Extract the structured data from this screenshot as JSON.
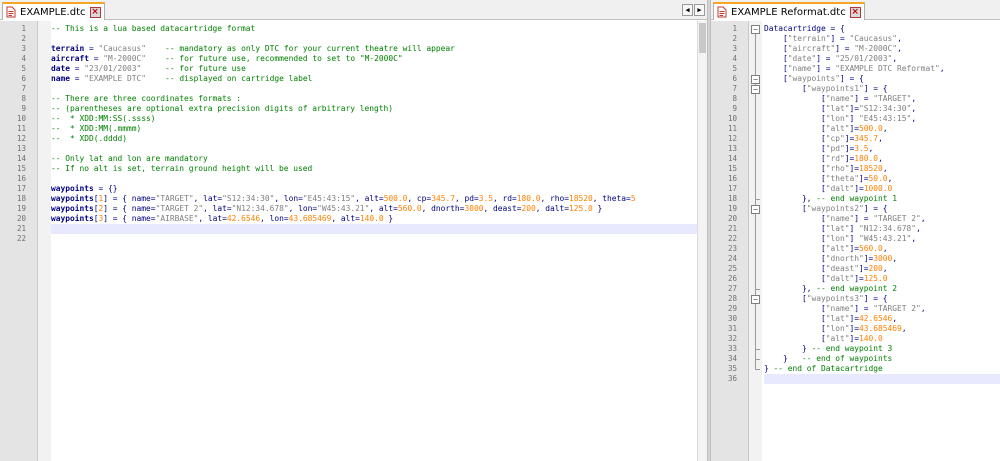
{
  "left_pane": {
    "tab": {
      "label": "EXAMPLE.dtc"
    },
    "lines": [
      [
        [
          "cm",
          "-- This is a lua based datacartridge format"
        ]
      ],
      [],
      [
        [
          "kw",
          "terrain"
        ],
        [
          "op",
          " = "
        ],
        [
          "st",
          "\"Caucasus\""
        ],
        [
          "op",
          "    "
        ],
        [
          "cm",
          "-- mandatory as only DTC for your current theatre will appear"
        ]
      ],
      [
        [
          "kw",
          "aircraft"
        ],
        [
          "op",
          " = "
        ],
        [
          "st",
          "\"M-2000C\""
        ],
        [
          "op",
          "    "
        ],
        [
          "cm",
          "-- for future use, recommended to set to \"M-2000C\""
        ]
      ],
      [
        [
          "kw",
          "date"
        ],
        [
          "op",
          " = "
        ],
        [
          "st",
          "\"23/01/2003\""
        ],
        [
          "op",
          "     "
        ],
        [
          "cm",
          "-- for future use"
        ]
      ],
      [
        [
          "kw",
          "name"
        ],
        [
          "op",
          " = "
        ],
        [
          "st",
          "\"EXAMPLE DTC\""
        ],
        [
          "op",
          "    "
        ],
        [
          "cm",
          "-- displayed on cartridge label"
        ]
      ],
      [],
      [
        [
          "cm",
          "-- There are three coordinates formats :"
        ]
      ],
      [
        [
          "cm",
          "-- (parentheses are optional extra precision digits of arbitrary length)"
        ]
      ],
      [
        [
          "cm",
          "--  * XDD:MM:SS(.ssss)"
        ]
      ],
      [
        [
          "cm",
          "--  * XDD:MM(.mmmm)"
        ]
      ],
      [
        [
          "cm",
          "--  * XDD(.dddd)"
        ]
      ],
      [],
      [
        [
          "cm",
          "-- Only lat and lon are mandatory"
        ]
      ],
      [
        [
          "cm",
          "-- If no alt is set, terrain ground height will be used"
        ]
      ],
      [],
      [
        [
          "kw",
          "waypoints"
        ],
        [
          "op",
          " = {}"
        ]
      ],
      [
        [
          "kw",
          "waypoints"
        ],
        [
          "op",
          "["
        ],
        [
          "nu",
          "1"
        ],
        [
          "op",
          "] = { name="
        ],
        [
          "st",
          "\"TARGET\""
        ],
        [
          "op",
          ", lat="
        ],
        [
          "st",
          "\"S12:34:30\""
        ],
        [
          "op",
          ", lon="
        ],
        [
          "st",
          "\"E45:43:15\""
        ],
        [
          "op",
          ", alt="
        ],
        [
          "nu",
          "500.0"
        ],
        [
          "op",
          ", cp="
        ],
        [
          "nu",
          "345.7"
        ],
        [
          "op",
          ", pd="
        ],
        [
          "nu",
          "3.5"
        ],
        [
          "op",
          ", rd="
        ],
        [
          "nu",
          "180.0"
        ],
        [
          "op",
          ", rho="
        ],
        [
          "nu",
          "18520"
        ],
        [
          "op",
          ", theta="
        ],
        [
          "nu",
          "5"
        ]
      ],
      [
        [
          "kw",
          "waypoints"
        ],
        [
          "op",
          "["
        ],
        [
          "nu",
          "2"
        ],
        [
          "op",
          "] = { name="
        ],
        [
          "st",
          "\"TARGET 2\""
        ],
        [
          "op",
          ", lat="
        ],
        [
          "st",
          "\"N12:34.678\""
        ],
        [
          "op",
          ", lon="
        ],
        [
          "st",
          "\"W45:43.21\""
        ],
        [
          "op",
          ", alt="
        ],
        [
          "nu",
          "560.0"
        ],
        [
          "op",
          ", dnorth="
        ],
        [
          "nu",
          "3000"
        ],
        [
          "op",
          ", deast="
        ],
        [
          "nu",
          "200"
        ],
        [
          "op",
          ", dalt="
        ],
        [
          "nu",
          "125.0"
        ],
        [
          "op",
          " }"
        ]
      ],
      [
        [
          "kw",
          "waypoints"
        ],
        [
          "op",
          "["
        ],
        [
          "nu",
          "3"
        ],
        [
          "op",
          "] = { name="
        ],
        [
          "st",
          "\"AIRBASE\""
        ],
        [
          "op",
          ", lat="
        ],
        [
          "nu",
          "42.6546"
        ],
        [
          "op",
          ", lon="
        ],
        [
          "nu",
          "43.685469"
        ],
        [
          "op",
          ", alt="
        ],
        [
          "nu",
          "140.0"
        ],
        [
          "op",
          " }"
        ]
      ],
      [],
      []
    ],
    "current_line": 21,
    "scroll_left_label": "◀",
    "scroll_right_label": "▶"
  },
  "right_pane": {
    "tab": {
      "label": "EXAMPLE Reformat.dtc"
    },
    "lines": [
      [
        [
          "op",
          "Datacartridge = {"
        ]
      ],
      [
        [
          "op",
          "    ["
        ],
        [
          "st",
          "\"terrain\""
        ],
        [
          "op",
          "] = "
        ],
        [
          "st",
          "\"Caucasus\""
        ],
        [
          "op",
          ","
        ]
      ],
      [
        [
          "op",
          "    ["
        ],
        [
          "st",
          "\"aircraft\""
        ],
        [
          "op",
          "] = "
        ],
        [
          "st",
          "\"M-2000C\""
        ],
        [
          "op",
          ","
        ]
      ],
      [
        [
          "op",
          "    ["
        ],
        [
          "st",
          "\"date\""
        ],
        [
          "op",
          "] = "
        ],
        [
          "st",
          "\"25/01/2003\""
        ],
        [
          "op",
          ","
        ]
      ],
      [
        [
          "op",
          "    ["
        ],
        [
          "st",
          "\"name\""
        ],
        [
          "op",
          "] = "
        ],
        [
          "st",
          "\"EXAMPLE DTC Reformat\""
        ],
        [
          "op",
          ","
        ]
      ],
      [
        [
          "op",
          "    ["
        ],
        [
          "st",
          "\"waypoints\""
        ],
        [
          "op",
          "] = {"
        ]
      ],
      [
        [
          "op",
          "        ["
        ],
        [
          "st",
          "\"waypoints1\""
        ],
        [
          "op",
          "] = {"
        ]
      ],
      [
        [
          "op",
          "            ["
        ],
        [
          "st",
          "\"name\""
        ],
        [
          "op",
          "] = "
        ],
        [
          "st",
          "\"TARGET\""
        ],
        [
          "op",
          ","
        ]
      ],
      [
        [
          "op",
          "            ["
        ],
        [
          "st",
          "\"lat\""
        ],
        [
          "op",
          "]="
        ],
        [
          "st",
          "\"S12:34:30\""
        ],
        [
          "op",
          ","
        ]
      ],
      [
        [
          "op",
          "            ["
        ],
        [
          "st",
          "\"lon\""
        ],
        [
          "op",
          "] "
        ],
        [
          "st",
          "\"E45:43:15\""
        ],
        [
          "op",
          ","
        ]
      ],
      [
        [
          "op",
          "            ["
        ],
        [
          "st",
          "\"alt\""
        ],
        [
          "op",
          "]="
        ],
        [
          "nu",
          "500.0"
        ],
        [
          "op",
          ","
        ]
      ],
      [
        [
          "op",
          "            ["
        ],
        [
          "st",
          "\"cp\""
        ],
        [
          "op",
          "]="
        ],
        [
          "nu",
          "345.7"
        ],
        [
          "op",
          ","
        ]
      ],
      [
        [
          "op",
          "            ["
        ],
        [
          "st",
          "\"pd\""
        ],
        [
          "op",
          "]="
        ],
        [
          "nu",
          "3.5"
        ],
        [
          "op",
          ","
        ]
      ],
      [
        [
          "op",
          "            ["
        ],
        [
          "st",
          "\"rd\""
        ],
        [
          "op",
          "]="
        ],
        [
          "nu",
          "180.0"
        ],
        [
          "op",
          ","
        ]
      ],
      [
        [
          "op",
          "            ["
        ],
        [
          "st",
          "\"rho\""
        ],
        [
          "op",
          "]="
        ],
        [
          "nu",
          "18520"
        ],
        [
          "op",
          ","
        ]
      ],
      [
        [
          "op",
          "            ["
        ],
        [
          "st",
          "\"theta\""
        ],
        [
          "op",
          "]="
        ],
        [
          "nu",
          "50.0"
        ],
        [
          "op",
          ","
        ]
      ],
      [
        [
          "op",
          "            ["
        ],
        [
          "st",
          "\"dalt\""
        ],
        [
          "op",
          "]="
        ],
        [
          "nu",
          "1000.0"
        ]
      ],
      [
        [
          "op",
          "        }, "
        ],
        [
          "cm",
          "-- end waypoint 1"
        ]
      ],
      [
        [
          "op",
          "        ["
        ],
        [
          "st",
          "\"waypoints2\""
        ],
        [
          "op",
          "] = {"
        ]
      ],
      [
        [
          "op",
          "            ["
        ],
        [
          "st",
          "\"name\""
        ],
        [
          "op",
          "] = "
        ],
        [
          "st",
          "\"TARGET 2\""
        ],
        [
          "op",
          ","
        ]
      ],
      [
        [
          "op",
          "            ["
        ],
        [
          "st",
          "\"lat\""
        ],
        [
          "op",
          "] "
        ],
        [
          "st",
          "\"N12:34.678\""
        ],
        [
          "op",
          ","
        ]
      ],
      [
        [
          "op",
          "            ["
        ],
        [
          "st",
          "\"lon\""
        ],
        [
          "op",
          "] "
        ],
        [
          "st",
          "\"W45:43.21\""
        ],
        [
          "op",
          ","
        ]
      ],
      [
        [
          "op",
          "            ["
        ],
        [
          "st",
          "\"alt\""
        ],
        [
          "op",
          "]="
        ],
        [
          "nu",
          "560.0"
        ],
        [
          "op",
          ","
        ]
      ],
      [
        [
          "op",
          "            ["
        ],
        [
          "st",
          "\"dnorth\""
        ],
        [
          "op",
          "]="
        ],
        [
          "nu",
          "3000"
        ],
        [
          "op",
          ","
        ]
      ],
      [
        [
          "op",
          "            ["
        ],
        [
          "st",
          "\"deast\""
        ],
        [
          "op",
          "]="
        ],
        [
          "nu",
          "200"
        ],
        [
          "op",
          ","
        ]
      ],
      [
        [
          "op",
          "            ["
        ],
        [
          "st",
          "\"dalt\""
        ],
        [
          "op",
          "]="
        ],
        [
          "nu",
          "125.0"
        ]
      ],
      [
        [
          "op",
          "        }, "
        ],
        [
          "cm",
          "-- end waypoint 2"
        ]
      ],
      [
        [
          "op",
          "        ["
        ],
        [
          "st",
          "\"waypoints3\""
        ],
        [
          "op",
          "] = {"
        ]
      ],
      [
        [
          "op",
          "            ["
        ],
        [
          "st",
          "\"name\""
        ],
        [
          "op",
          "] = "
        ],
        [
          "st",
          "\"TARGET 2\""
        ],
        [
          "op",
          ","
        ]
      ],
      [
        [
          "op",
          "            ["
        ],
        [
          "st",
          "\"lat\""
        ],
        [
          "op",
          "]="
        ],
        [
          "nu",
          "42.6546"
        ],
        [
          "op",
          ","
        ]
      ],
      [
        [
          "op",
          "            ["
        ],
        [
          "st",
          "\"lon\""
        ],
        [
          "op",
          "]="
        ],
        [
          "nu",
          "43.685469"
        ],
        [
          "op",
          ","
        ]
      ],
      [
        [
          "op",
          "            ["
        ],
        [
          "st",
          "\"alt\""
        ],
        [
          "op",
          "]="
        ],
        [
          "nu",
          "140.0"
        ]
      ],
      [
        [
          "op",
          "        } "
        ],
        [
          "cm",
          "-- end waypoint 3"
        ]
      ],
      [
        [
          "op",
          "    }   "
        ],
        [
          "cm",
          "-- end of waypoints"
        ]
      ],
      [
        [
          "op",
          "} "
        ],
        [
          "cm",
          "-- end of Datacartridge"
        ]
      ],
      []
    ],
    "current_line": 36,
    "fold_markers": [
      "minus",
      "",
      "",
      "",
      "",
      "minus",
      "minus",
      "",
      "",
      "",
      "",
      "",
      "",
      "",
      "",
      "",
      "",
      "end",
      "minus",
      "",
      "",
      "",
      "",
      "",
      "",
      "",
      "end",
      "minus",
      "",
      "",
      "",
      "",
      "end",
      "end",
      "end",
      ""
    ]
  },
  "colors": {
    "comment": "#008000",
    "keyword": "#000080",
    "string": "#808080",
    "number": "#ff8000",
    "current_line": "#e8e8ff",
    "tab_accent": "#f5a623"
  }
}
